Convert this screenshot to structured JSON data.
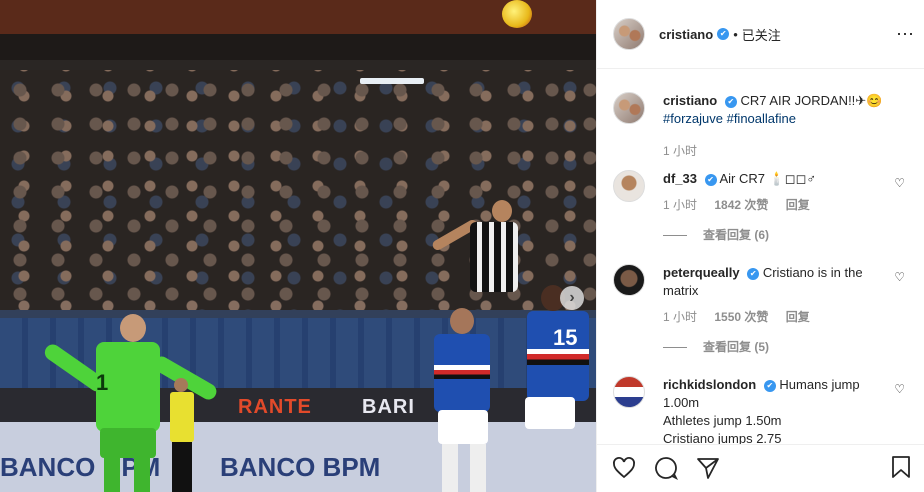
{
  "post": {
    "ads": [
      "RANTE",
      "BARI"
    ],
    "banners": [
      "BANCO BPM",
      "BANCO BPM"
    ],
    "keeper_number": "1",
    "blue_number": "15"
  },
  "header": {
    "username": "cristiano",
    "verified": "✔",
    "separator": "•",
    "follow_status": "已关注",
    "more_icon": "⋯"
  },
  "caption": {
    "username": "cristiano",
    "text": "CR7 AIR JORDAN!!✈😊",
    "hashtags": "#forzajuve #fino​allafine",
    "time": "1 小时"
  },
  "comments": [
    {
      "username": "df_33",
      "text": "Air CR7 🕯️◻◻♂",
      "time": "1 小时",
      "likes": "1842 次赞",
      "reply": "回复",
      "view_replies": "查看回复 (6)"
    },
    {
      "username": "peterqueally",
      "text": "Cristiano is in the matrix",
      "time": "1 小时",
      "likes": "1550 次赞",
      "reply": "回复",
      "view_replies": "查看回复 (5)"
    },
    {
      "username": "richkidslondon",
      "text_lines": [
        "Humans jump",
        "1.00m",
        "Athletes jump 1.50m",
        "Cristiano jumps 2.75"
      ]
    }
  ],
  "icons": {
    "next": "›",
    "heart": "♡"
  }
}
